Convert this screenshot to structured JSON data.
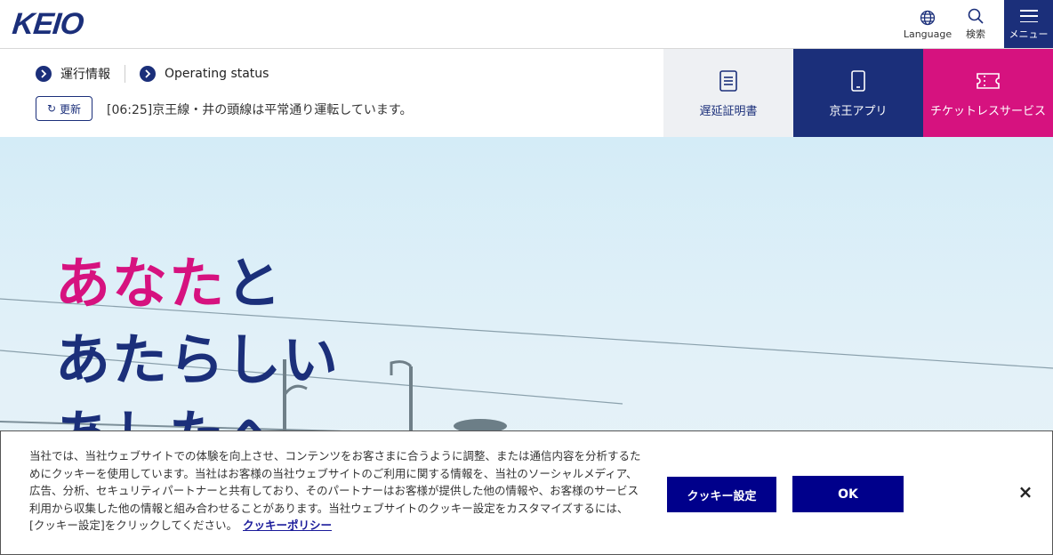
{
  "header": {
    "logo_text": "KEIO",
    "language_label": "Language",
    "search_label": "検索",
    "menu_label": "メニュー"
  },
  "status": {
    "operating_info_label": "運行情報",
    "operating_status_label": "Operating status",
    "update_button_label": "更新",
    "message": "[06:25]京王線・井の頭線は平常通り運転しています。"
  },
  "tiles": {
    "delay_certificate": "遅延証明書",
    "keio_app": "京王アプリ",
    "ticketless": "チケットレスサービス"
  },
  "hero": {
    "line1_pink": "あなた",
    "line1_rest": "と",
    "line2": "あたらしい",
    "line3": "あしたへ"
  },
  "cookie": {
    "text": "当社では、当社ウェブサイトでの体験を向上させ、コンテンツをお客さまに合うように調整、または通信内容を分析するためにクッキーを使用しています。当社はお客様の当社ウェブサイトのご利用に関する情報を、当社のソーシャルメディア、広告、分析、セキュリティパートナーと共有しており、そのパートナーはお客様が提供した他の情報や、お客様のサービス利用から収集した他の情報と組み合わせることがあります。当社ウェブサイトのクッキー設定をカスタマイズするには、[クッキー設定]をクリックしてください。",
    "policy_link": "クッキーポリシー",
    "settings_button": "クッキー設定",
    "ok_button": "OK",
    "close_symbol": "×"
  },
  "colors": {
    "brand_navy": "#1b2f7a",
    "brand_pink": "#d6127f",
    "cookie_button": "#00008b"
  }
}
